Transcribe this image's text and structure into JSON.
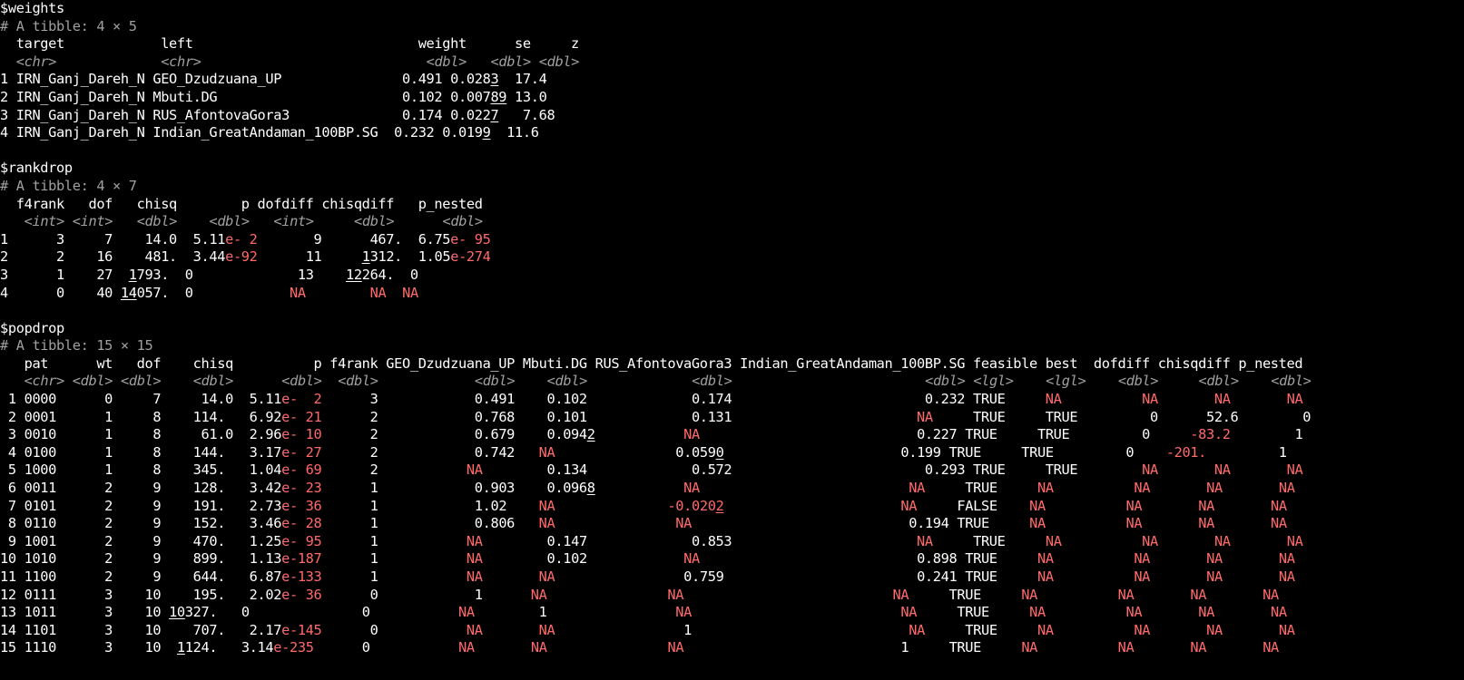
{
  "colors": {
    "background": "#000000",
    "text": "#ffffff",
    "meta": "#a0a0a0",
    "na_and_exponent": "#ff6a6a"
  },
  "lines": [
    [
      {
        "t": "$weights"
      }
    ],
    [
      {
        "t": "# A tibble: 4 × 5",
        "c": "gray-n"
      }
    ],
    [
      {
        "t": "  target            left                            weight      se     z"
      }
    ],
    [
      {
        "t": "  "
      },
      {
        "t": "<chr>",
        "c": "gray"
      },
      {
        "t": "             "
      },
      {
        "t": "<chr>",
        "c": "gray"
      },
      {
        "t": "                            "
      },
      {
        "t": "<dbl>",
        "c": "gray"
      },
      {
        "t": "   "
      },
      {
        "t": "<dbl>",
        "c": "gray"
      },
      {
        "t": " "
      },
      {
        "t": "<dbl>",
        "c": "gray"
      }
    ],
    [
      {
        "t": "1 IRN_Ganj_Dareh_N GEO_Dzudzuana_UP               0.491 0.028"
      },
      {
        "t": "3",
        "c": "u"
      },
      {
        "t": "  17.4 "
      }
    ],
    [
      {
        "t": "2 IRN_Ganj_Dareh_N Mbuti.DG                       0.102 0.007"
      },
      {
        "t": "89",
        "c": "u"
      },
      {
        "t": " 13.0 "
      }
    ],
    [
      {
        "t": "3 IRN_Ganj_Dareh_N RUS_AfontovaGora3              0.174 0.022"
      },
      {
        "t": "7",
        "c": "u"
      },
      {
        "t": "   7.68"
      }
    ],
    [
      {
        "t": "4 IRN_Ganj_Dareh_N Indian_GreatAndaman_100BP.SG  0.232 0.019"
      },
      {
        "t": "9",
        "c": "u"
      },
      {
        "t": "  11.6 "
      }
    ],
    [
      {
        "t": ""
      }
    ],
    [
      {
        "t": "$rankdrop"
      }
    ],
    [
      {
        "t": "# A tibble: 4 × 7",
        "c": "gray-n"
      }
    ],
    [
      {
        "t": "  f4rank   dof   chisq        p dofdiff chisqdiff   p_nested"
      }
    ],
    [
      {
        "t": "   "
      },
      {
        "t": "<int>",
        "c": "gray"
      },
      {
        "t": " "
      },
      {
        "t": "<int>",
        "c": "gray"
      },
      {
        "t": "   "
      },
      {
        "t": "<dbl>",
        "c": "gray"
      },
      {
        "t": "    "
      },
      {
        "t": "<dbl>",
        "c": "gray"
      },
      {
        "t": "   "
      },
      {
        "t": "<int>",
        "c": "gray"
      },
      {
        "t": "     "
      },
      {
        "t": "<dbl>",
        "c": "gray"
      },
      {
        "t": "      "
      },
      {
        "t": "<dbl>",
        "c": "gray"
      }
    ],
    [
      {
        "t": "1      3     7    14.0  5.11"
      },
      {
        "t": "e- 2",
        "c": "red"
      },
      {
        "t": "       9      467.  6.75"
      },
      {
        "t": "e- 95",
        "c": "red"
      }
    ],
    [
      {
        "t": "2      2    16    481.  3.44"
      },
      {
        "t": "e-92",
        "c": "red"
      },
      {
        "t": "      11     "
      },
      {
        "t": "1",
        "c": "u"
      },
      {
        "t": "312.  1.05"
      },
      {
        "t": "e-274",
        "c": "red"
      }
    ],
    [
      {
        "t": "3      1    27  "
      },
      {
        "t": "1",
        "c": "u"
      },
      {
        "t": "793.  0             13    "
      },
      {
        "t": "12",
        "c": "u"
      },
      {
        "t": "264.  0       "
      }
    ],
    [
      {
        "t": "4      0    40 "
      },
      {
        "t": "14",
        "c": "u"
      },
      {
        "t": "057.  0            "
      },
      {
        "t": "NA",
        "c": "red"
      },
      {
        "t": "        "
      },
      {
        "t": "NA",
        "c": "red"
      },
      {
        "t": "  "
      },
      {
        "t": "NA",
        "c": "red"
      }
    ],
    [
      {
        "t": ""
      }
    ],
    [
      {
        "t": "$popdrop"
      }
    ],
    [
      {
        "t": "# A tibble: 15 × 15",
        "c": "gray-n"
      }
    ],
    [
      {
        "t": "   pat      wt   dof    chisq          p f4rank GEO_Dzudzuana_UP Mbuti.DG RUS_AfontovaGora3 Indian_GreatAndaman_100BP.SG feasible best  dofdiff chisqdiff p_nested"
      }
    ],
    [
      {
        "t": "   "
      },
      {
        "t": "<chr>",
        "c": "gray"
      },
      {
        "t": " "
      },
      {
        "t": "<dbl>",
        "c": "gray"
      },
      {
        "t": " "
      },
      {
        "t": "<dbl>",
        "c": "gray"
      },
      {
        "t": "    "
      },
      {
        "t": "<dbl>",
        "c": "gray"
      },
      {
        "t": "      "
      },
      {
        "t": "<dbl>",
        "c": "gray"
      },
      {
        "t": "  "
      },
      {
        "t": "<dbl>",
        "c": "gray"
      },
      {
        "t": "            "
      },
      {
        "t": "<dbl>",
        "c": "gray"
      },
      {
        "t": "    "
      },
      {
        "t": "<dbl>",
        "c": "gray"
      },
      {
        "t": "             "
      },
      {
        "t": "<dbl>",
        "c": "gray"
      },
      {
        "t": "                        "
      },
      {
        "t": "<dbl>",
        "c": "gray"
      },
      {
        "t": " "
      },
      {
        "t": "<lgl>",
        "c": "gray"
      },
      {
        "t": "    "
      },
      {
        "t": "<lgl>",
        "c": "gray"
      },
      {
        "t": "    "
      },
      {
        "t": "<dbl>",
        "c": "gray"
      },
      {
        "t": "     "
      },
      {
        "t": "<dbl>",
        "c": "gray"
      },
      {
        "t": "    "
      },
      {
        "t": "<dbl>",
        "c": "gray"
      }
    ],
    [
      {
        "t": " 1 0000      0     7     14.0  5.11"
      },
      {
        "t": "e-  2",
        "c": "red"
      },
      {
        "t": "      3            0.491    0.102             0.174                        0.232 TRUE     "
      },
      {
        "t": "NA",
        "c": "red"
      },
      {
        "t": "          "
      },
      {
        "t": "NA",
        "c": "red"
      },
      {
        "t": "       "
      },
      {
        "t": "NA",
        "c": "red"
      },
      {
        "t": "       "
      },
      {
        "t": "NA",
        "c": "red"
      }
    ],
    [
      {
        "t": " 2 0001      1     8    114.   6.92"
      },
      {
        "t": "e- 21",
        "c": "red"
      },
      {
        "t": "      2            0.768    0.101             0.131                       "
      },
      {
        "t": "NA",
        "c": "red"
      },
      {
        "t": "     TRUE     TRUE         0      52.6        0"
      }
    ],
    [
      {
        "t": " 3 0010      1     8     61.0  2.96"
      },
      {
        "t": "e- 10",
        "c": "red"
      },
      {
        "t": "      2            0.679    0.094"
      },
      {
        "t": "2",
        "c": "u"
      },
      {
        "t": "           "
      },
      {
        "t": "NA",
        "c": "red"
      },
      {
        "t": "                           0.227 TRUE     TRUE         0     "
      },
      {
        "t": "-83.2",
        "c": "red"
      },
      {
        "t": "        1"
      }
    ],
    [
      {
        "t": " 4 0100      1     8    144.   3.17"
      },
      {
        "t": "e- 27",
        "c": "red"
      },
      {
        "t": "      2            0.742   "
      },
      {
        "t": "NA",
        "c": "red"
      },
      {
        "t": "               0.059"
      },
      {
        "t": "0",
        "c": "u"
      },
      {
        "t": "                      0.199 TRUE     TRUE         0    "
      },
      {
        "t": "-201.",
        "c": "red"
      },
      {
        "t": "         1"
      }
    ],
    [
      {
        "t": " 5 1000      1     8    345.   1.04"
      },
      {
        "t": "e- 69",
        "c": "red"
      },
      {
        "t": "      2           "
      },
      {
        "t": "NA",
        "c": "red"
      },
      {
        "t": "        0.134             0.572                        0.293 TRUE     TRUE        "
      },
      {
        "t": "NA",
        "c": "red"
      },
      {
        "t": "       "
      },
      {
        "t": "NA",
        "c": "red"
      },
      {
        "t": "       "
      },
      {
        "t": "NA",
        "c": "red"
      }
    ],
    [
      {
        "t": " 6 0011      2     9    128.   3.42"
      },
      {
        "t": "e- 23",
        "c": "red"
      },
      {
        "t": "      1            0.903    0.096"
      },
      {
        "t": "8",
        "c": "u"
      },
      {
        "t": "           "
      },
      {
        "t": "NA",
        "c": "red"
      },
      {
        "t": "                          "
      },
      {
        "t": "NA",
        "c": "red"
      },
      {
        "t": "     TRUE     "
      },
      {
        "t": "NA",
        "c": "red"
      },
      {
        "t": "          "
      },
      {
        "t": "NA",
        "c": "red"
      },
      {
        "t": "       "
      },
      {
        "t": "NA",
        "c": "red"
      },
      {
        "t": "       "
      },
      {
        "t": "NA",
        "c": "red"
      }
    ],
    [
      {
        "t": " 7 0101      2     9    191.   2.73"
      },
      {
        "t": "e- 36",
        "c": "red"
      },
      {
        "t": "      1            1.02    "
      },
      {
        "t": "NA",
        "c": "red"
      },
      {
        "t": "              "
      },
      {
        "t": "-0.020",
        "c": "red"
      },
      {
        "t": "2",
        "c": "red u"
      },
      {
        "t": "                      "
      },
      {
        "t": "NA",
        "c": "red"
      },
      {
        "t": "     FALSE    "
      },
      {
        "t": "NA",
        "c": "red"
      },
      {
        "t": "          "
      },
      {
        "t": "NA",
        "c": "red"
      },
      {
        "t": "       "
      },
      {
        "t": "NA",
        "c": "red"
      },
      {
        "t": "       "
      },
      {
        "t": "NA",
        "c": "red"
      }
    ],
    [
      {
        "t": " 8 0110      2     9    152.   3.46"
      },
      {
        "t": "e- 28",
        "c": "red"
      },
      {
        "t": "      1            0.806   "
      },
      {
        "t": "NA",
        "c": "red"
      },
      {
        "t": "               "
      },
      {
        "t": "NA",
        "c": "red"
      },
      {
        "t": "                           0.194 TRUE     "
      },
      {
        "t": "NA",
        "c": "red"
      },
      {
        "t": "          "
      },
      {
        "t": "NA",
        "c": "red"
      },
      {
        "t": "       "
      },
      {
        "t": "NA",
        "c": "red"
      },
      {
        "t": "       "
      },
      {
        "t": "NA",
        "c": "red"
      }
    ],
    [
      {
        "t": " 9 1001      2     9    470.   1.25"
      },
      {
        "t": "e- 95",
        "c": "red"
      },
      {
        "t": "      1           "
      },
      {
        "t": "NA",
        "c": "red"
      },
      {
        "t": "        0.147             0.853                       "
      },
      {
        "t": "NA",
        "c": "red"
      },
      {
        "t": "     TRUE     "
      },
      {
        "t": "NA",
        "c": "red"
      },
      {
        "t": "          "
      },
      {
        "t": "NA",
        "c": "red"
      },
      {
        "t": "       "
      },
      {
        "t": "NA",
        "c": "red"
      },
      {
        "t": "       "
      },
      {
        "t": "NA",
        "c": "red"
      }
    ],
    [
      {
        "t": "10 1010      2     9    899.   1.13"
      },
      {
        "t": "e-187",
        "c": "red"
      },
      {
        "t": "      1           "
      },
      {
        "t": "NA",
        "c": "red"
      },
      {
        "t": "        0.102            "
      },
      {
        "t": "NA",
        "c": "red"
      },
      {
        "t": "                           0.898 TRUE     "
      },
      {
        "t": "NA",
        "c": "red"
      },
      {
        "t": "          "
      },
      {
        "t": "NA",
        "c": "red"
      },
      {
        "t": "       "
      },
      {
        "t": "NA",
        "c": "red"
      },
      {
        "t": "       "
      },
      {
        "t": "NA",
        "c": "red"
      }
    ],
    [
      {
        "t": "11 1100      2     9    644.   6.87"
      },
      {
        "t": "e-133",
        "c": "red"
      },
      {
        "t": "      1           "
      },
      {
        "t": "NA",
        "c": "red"
      },
      {
        "t": "       "
      },
      {
        "t": "NA",
        "c": "red"
      },
      {
        "t": "                0.759                        0.241 TRUE     "
      },
      {
        "t": "NA",
        "c": "red"
      },
      {
        "t": "          "
      },
      {
        "t": "NA",
        "c": "red"
      },
      {
        "t": "       "
      },
      {
        "t": "NA",
        "c": "red"
      },
      {
        "t": "       "
      },
      {
        "t": "NA",
        "c": "red"
      }
    ],
    [
      {
        "t": "12 0111      3    10    195.   2.02"
      },
      {
        "t": "e- 36",
        "c": "red"
      },
      {
        "t": "      0            1      "
      },
      {
        "t": "NA",
        "c": "red"
      },
      {
        "t": "               "
      },
      {
        "t": "NA",
        "c": "red"
      },
      {
        "t": "                          "
      },
      {
        "t": "NA",
        "c": "red"
      },
      {
        "t": "     TRUE     "
      },
      {
        "t": "NA",
        "c": "red"
      },
      {
        "t": "          "
      },
      {
        "t": "NA",
        "c": "red"
      },
      {
        "t": "       "
      },
      {
        "t": "NA",
        "c": "red"
      },
      {
        "t": "       "
      },
      {
        "t": "NA",
        "c": "red"
      }
    ],
    [
      {
        "t": "13 1011      3    10 "
      },
      {
        "t": "10",
        "c": "u"
      },
      {
        "t": "327.   0              0           "
      },
      {
        "t": "NA",
        "c": "red"
      },
      {
        "t": "        1                "
      },
      {
        "t": "NA",
        "c": "red"
      },
      {
        "t": "                          "
      },
      {
        "t": "NA",
        "c": "red"
      },
      {
        "t": "     TRUE     "
      },
      {
        "t": "NA",
        "c": "red"
      },
      {
        "t": "          "
      },
      {
        "t": "NA",
        "c": "red"
      },
      {
        "t": "       "
      },
      {
        "t": "NA",
        "c": "red"
      },
      {
        "t": "       "
      },
      {
        "t": "NA",
        "c": "red"
      }
    ],
    [
      {
        "t": "14 1101      3    10    707.   2.17"
      },
      {
        "t": "e-145",
        "c": "red"
      },
      {
        "t": "      0           "
      },
      {
        "t": "NA",
        "c": "red"
      },
      {
        "t": "       "
      },
      {
        "t": "NA",
        "c": "red"
      },
      {
        "t": "                1                           "
      },
      {
        "t": "NA",
        "c": "red"
      },
      {
        "t": "     TRUE     "
      },
      {
        "t": "NA",
        "c": "red"
      },
      {
        "t": "          "
      },
      {
        "t": "NA",
        "c": "red"
      },
      {
        "t": "       "
      },
      {
        "t": "NA",
        "c": "red"
      },
      {
        "t": "       "
      },
      {
        "t": "NA",
        "c": "red"
      }
    ],
    [
      {
        "t": "15 1110      3    10  "
      },
      {
        "t": "1",
        "c": "u"
      },
      {
        "t": "124.   3.14"
      },
      {
        "t": "e-235",
        "c": "red"
      },
      {
        "t": "      0           "
      },
      {
        "t": "NA",
        "c": "red"
      },
      {
        "t": "       "
      },
      {
        "t": "NA",
        "c": "red"
      },
      {
        "t": "               "
      },
      {
        "t": "NA",
        "c": "red"
      },
      {
        "t": "                           1     TRUE     "
      },
      {
        "t": "NA",
        "c": "red"
      },
      {
        "t": "          "
      },
      {
        "t": "NA",
        "c": "red"
      },
      {
        "t": "       "
      },
      {
        "t": "NA",
        "c": "red"
      },
      {
        "t": "       "
      },
      {
        "t": "NA",
        "c": "red"
      }
    ]
  ]
}
